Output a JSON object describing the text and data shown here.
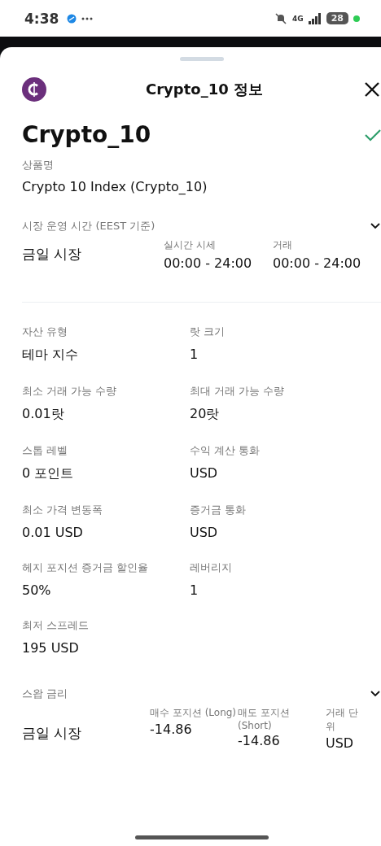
{
  "status_bar": {
    "time": "4:38",
    "network": "4G",
    "battery": "28"
  },
  "header": {
    "title": "Crypto_10 정보"
  },
  "symbol": {
    "name": "Crypto_10",
    "product_label": "상품명",
    "product_value": "Crypto 10 Index (Crypto_10)"
  },
  "market_hours": {
    "label": "시장 운영 시간 (EEST 기준)",
    "expanded": false,
    "session": "금일 시장",
    "columns": [
      {
        "label": "실시간 시세",
        "value": "00:00 - 24:00"
      },
      {
        "label": "거래",
        "value": "00:00 - 24:00"
      }
    ]
  },
  "specs": [
    {
      "label": "자산 유형",
      "value": "테마 지수"
    },
    {
      "label": "랏 크기",
      "value": "1"
    },
    {
      "label": "최소 거래 가능 수량",
      "value": "0.01랏"
    },
    {
      "label": "최대 거래 가능 수량",
      "value": "20랏"
    },
    {
      "label": "스톱 레벨",
      "value": "0 포인트"
    },
    {
      "label": "수익 계산 통화",
      "value": "USD"
    },
    {
      "label": "최소 가격 변동폭",
      "value": "0.01 USD"
    },
    {
      "label": "증거금 통화",
      "value": "USD"
    },
    {
      "label": "헤지 포지션 증거금 할인율",
      "value": "50%"
    },
    {
      "label": "레버리지",
      "value": "1"
    },
    {
      "label": "최저 스프레드",
      "value": "195 USD"
    }
  ],
  "swap": {
    "label": "스왑 금리",
    "expanded": false,
    "session": "금일 시장",
    "columns": [
      {
        "label": "매수 포지션 (Long)",
        "value": "-14.86"
      },
      {
        "label": "매도 포지션 (Short)",
        "value": "-14.86"
      },
      {
        "label": "거래 단위",
        "value": "USD"
      }
    ]
  }
}
